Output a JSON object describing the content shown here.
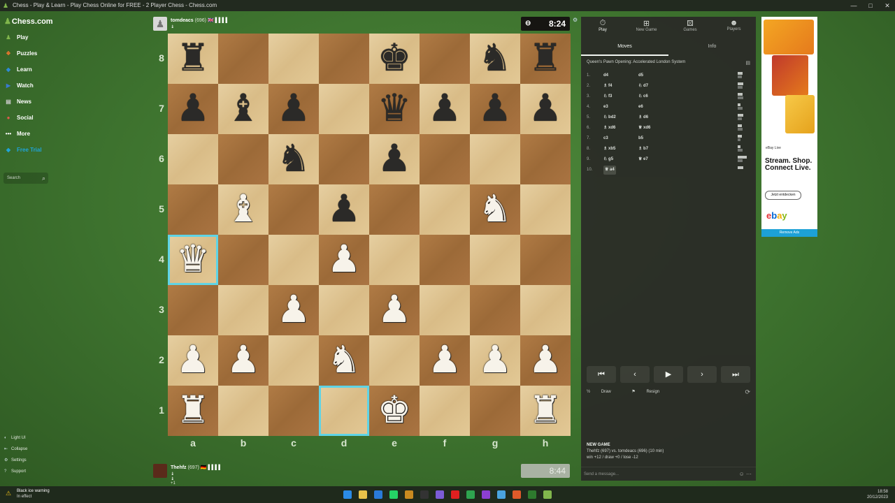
{
  "window": {
    "title": "Chess - Play & Learn - Play Chess Online for FREE - 2 Player Chess - Chess.com",
    "controls": [
      "—",
      "□",
      "✕"
    ]
  },
  "sidebar": {
    "logo": "Chess.com",
    "items": [
      {
        "label": "Play",
        "icon": "play-icon",
        "glyph": "♟",
        "color": "#81b64c"
      },
      {
        "label": "Puzzles",
        "icon": "puzzle-icon",
        "glyph": "❖",
        "color": "#e2752e"
      },
      {
        "label": "Learn",
        "icon": "learn-icon",
        "glyph": "◆",
        "color": "#2e8ad6"
      },
      {
        "label": "Watch",
        "icon": "watch-icon",
        "glyph": "▶",
        "color": "#3a7ad0"
      },
      {
        "label": "News",
        "icon": "news-icon",
        "glyph": "▤",
        "color": "#c9c9c9"
      },
      {
        "label": "Social",
        "icon": "social-icon",
        "glyph": "●",
        "color": "#e05b4d"
      },
      {
        "label": "More",
        "icon": "more-icon",
        "glyph": "•••",
        "color": "transparent"
      },
      {
        "label": "Free Trial",
        "icon": "diamond-icon",
        "glyph": "◆",
        "color": "#1fa4d8"
      }
    ],
    "search_placeholder": "Search",
    "bottom": [
      {
        "label": "Light UI",
        "glyph": "◐"
      },
      {
        "label": "Collapse",
        "glyph": "⇤"
      },
      {
        "label": "Settings",
        "glyph": "⚙"
      },
      {
        "label": "Support",
        "glyph": "?"
      }
    ]
  },
  "top_player": {
    "name": "tomdeacs",
    "rating": "(696)",
    "flag": "🇬🇧",
    "bars": "▌▌▌▌",
    "sub": "♝",
    "clock": "8:24"
  },
  "bottom_player": {
    "name": "Thehfz",
    "rating": "(697)",
    "flag": "🇩🇪",
    "bars": "▌▌▌▌",
    "sub": "♝ ♝ +1",
    "clock": "8:44"
  },
  "board": {
    "ranks": [
      "8",
      "7",
      "6",
      "5",
      "4",
      "3",
      "2",
      "1"
    ],
    "files": [
      "a",
      "b",
      "c",
      "d",
      "e",
      "f",
      "g",
      "h"
    ],
    "highlight": [
      "a4",
      "d1"
    ],
    "pieces": [
      {
        "sq": "a8",
        "p": "♜",
        "c": "b"
      },
      {
        "sq": "e8",
        "p": "♚",
        "c": "b"
      },
      {
        "sq": "g8",
        "p": "♞",
        "c": "b"
      },
      {
        "sq": "h8",
        "p": "♜",
        "c": "b"
      },
      {
        "sq": "a7",
        "p": "♟",
        "c": "b"
      },
      {
        "sq": "b7",
        "p": "♝",
        "c": "b"
      },
      {
        "sq": "c7",
        "p": "♟",
        "c": "b"
      },
      {
        "sq": "e7",
        "p": "♛",
        "c": "b"
      },
      {
        "sq": "f7",
        "p": "♟",
        "c": "b"
      },
      {
        "sq": "g7",
        "p": "♟",
        "c": "b"
      },
      {
        "sq": "h7",
        "p": "♟",
        "c": "b"
      },
      {
        "sq": "c6",
        "p": "♞",
        "c": "b"
      },
      {
        "sq": "e6",
        "p": "♟",
        "c": "b"
      },
      {
        "sq": "b5",
        "p": "♝",
        "c": "w"
      },
      {
        "sq": "d5",
        "p": "♟",
        "c": "b"
      },
      {
        "sq": "g5",
        "p": "♞",
        "c": "w"
      },
      {
        "sq": "a4",
        "p": "♛",
        "c": "w"
      },
      {
        "sq": "d4",
        "p": "♟",
        "c": "w"
      },
      {
        "sq": "c3",
        "p": "♟",
        "c": "w"
      },
      {
        "sq": "e3",
        "p": "♟",
        "c": "w"
      },
      {
        "sq": "a2",
        "p": "♟",
        "c": "w"
      },
      {
        "sq": "b2",
        "p": "♟",
        "c": "w"
      },
      {
        "sq": "d2",
        "p": "♞",
        "c": "w"
      },
      {
        "sq": "f2",
        "p": "♟",
        "c": "w"
      },
      {
        "sq": "g2",
        "p": "♟",
        "c": "w"
      },
      {
        "sq": "h2",
        "p": "♟",
        "c": "w"
      },
      {
        "sq": "a1",
        "p": "♜",
        "c": "w"
      },
      {
        "sq": "e1",
        "p": "♚",
        "c": "w"
      },
      {
        "sq": "h1",
        "p": "♜",
        "c": "w"
      }
    ]
  },
  "panel": {
    "tabs": [
      {
        "label": "Play",
        "glyph": "⏱",
        "icon": "stopwatch-icon"
      },
      {
        "label": "New Game",
        "glyph": "⊞",
        "icon": "new-game-icon"
      },
      {
        "label": "Games",
        "glyph": "⚄",
        "icon": "games-icon"
      },
      {
        "label": "Players",
        "glyph": "☻",
        "icon": "players-icon"
      }
    ],
    "subtabs": [
      "Moves",
      "Info"
    ],
    "opening": "Queen's Pawn Opening: Accelerated London System",
    "moves": [
      {
        "n": "1.",
        "w": "d4",
        "b": "d5",
        "tw": 0.5,
        "tb": 0.4
      },
      {
        "n": "2.",
        "w": "♗ f4",
        "b": "♘ d7",
        "tw": 0.6,
        "tb": 0.5
      },
      {
        "n": "3.",
        "w": "♘ f3",
        "b": "♘ c6",
        "tw": 0.5,
        "tb": 0.6
      },
      {
        "n": "4.",
        "w": "e3",
        "b": "e6",
        "tw": 0.3,
        "tb": 0.5
      },
      {
        "n": "5.",
        "w": "♘ bd2",
        "b": "♗ d6",
        "tw": 0.6,
        "tb": 0.4
      },
      {
        "n": "6.",
        "w": "♗ xd6",
        "b": "♕ xd6",
        "tw": 0.4,
        "tb": 0.5
      },
      {
        "n": "7.",
        "w": "c3",
        "b": "b5",
        "tw": 0.4,
        "tb": 0.3
      },
      {
        "n": "8.",
        "w": "♗ xb5",
        "b": "♗ b7",
        "tw": 0.3,
        "tb": 0.5
      },
      {
        "n": "9.",
        "w": "♘ g5",
        "b": "♕ e7",
        "tw": 0.9,
        "tb": 0.5
      },
      {
        "n": "10.",
        "w": "♕ a4",
        "b": "",
        "tw": 0.6,
        "tb": 0
      }
    ],
    "controls": [
      "⏮",
      "‹",
      "▶",
      "›",
      "⏭"
    ],
    "draw": "Draw",
    "resign": "Resign",
    "new_game_heading": "NEW GAME",
    "new_game_line1": "Thehfz (697) vs. tomdeacs (696) (10 min)",
    "new_game_line2": "win +12 / draw +0 / lose -12",
    "chat_placeholder": "Send a message..."
  },
  "ad": {
    "brand": "eBay Live",
    "headline": "Stream. Shop. Connect Live.",
    "cta": "Jetzt entdecken",
    "logo": "ebay",
    "remove": "Remove Ads"
  },
  "taskbar": {
    "weather1": "Black ice warning",
    "weather2": "In effect",
    "time": "18:58",
    "date": "20/12/2023"
  }
}
